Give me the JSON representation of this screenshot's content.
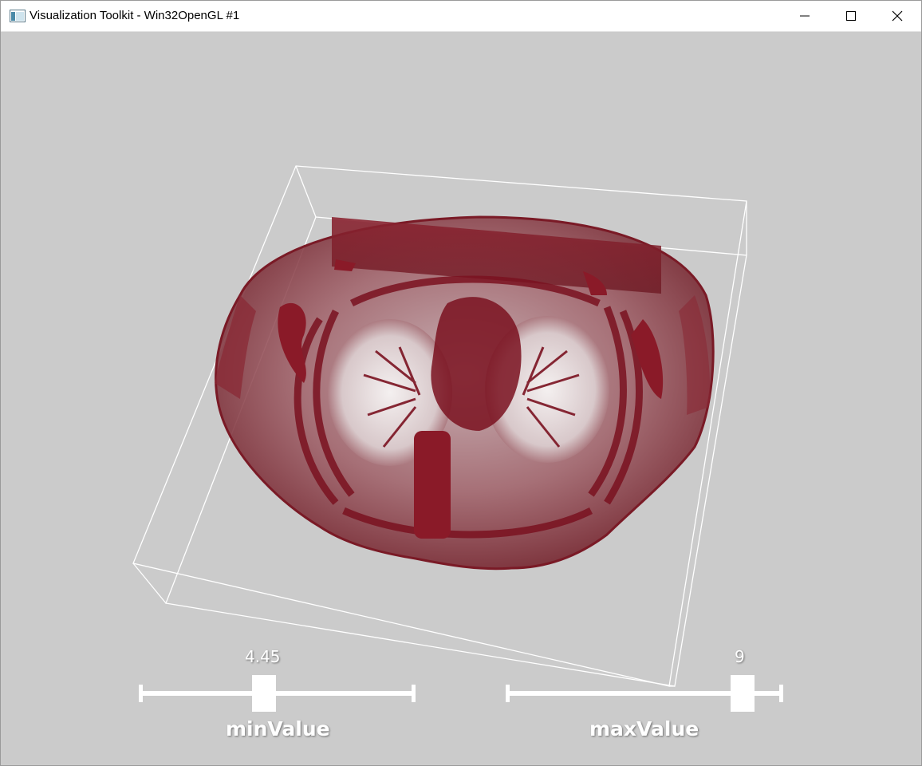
{
  "window": {
    "title": "Visualization Toolkit - Win32OpenGL #1",
    "controls": [
      "minimize",
      "maximize",
      "close"
    ]
  },
  "icons": {
    "app": "vtk-window-icon",
    "minimize": "minimize-icon",
    "maximize": "maximize-icon",
    "close": "close-icon"
  },
  "scene": {
    "background_color": "#cbcbcb",
    "outline_color": "#ffffff",
    "volume_color": "#7a1220",
    "content": "volume-rendered chest CT inside bounding-box outline"
  },
  "sliders": {
    "min": {
      "title": "minValue",
      "value": 4.45,
      "value_text": "4.45"
    },
    "max": {
      "title": "maxValue",
      "value": 9,
      "value_text": "9"
    }
  }
}
